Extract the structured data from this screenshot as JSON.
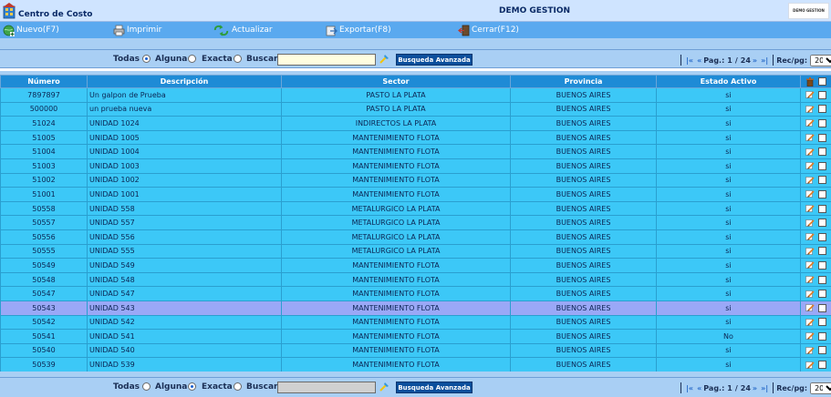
{
  "titlebar": {
    "app_title": "Centro de Costo",
    "company_title": "DEMO GESTION",
    "company_logo_text": "DEMO GESTION"
  },
  "toolbar": {
    "nuevo_label": "Nuevo(F7)",
    "imprimir_label": "Imprimir",
    "actualizar_label": "Actualizar",
    "exportar_label": "Exportar(F8)",
    "cerrar_label": "Cerrar(F12)"
  },
  "search_top": {
    "todas_label": "Todas",
    "alguna_label": "Alguna",
    "exacta_label": "Exacta",
    "buscar_label": "Buscar",
    "search_value": "",
    "selected_mode": "Todas",
    "advanced_label": "Busqueda Avanzada"
  },
  "search_bottom": {
    "todas_label": "Todas",
    "alguna_label": "Alguna",
    "exacta_label": "Exacta",
    "buscar_label": "Buscar",
    "search_value": "",
    "selected_mode": "Alguna",
    "advanced_label": "Busqueda Avanzada"
  },
  "pager": {
    "first": "|«",
    "prev": "«",
    "page_label": "Pag.:",
    "current_page": "1",
    "page_sep": "/",
    "total_pages": "24",
    "next": "»",
    "last": "»|",
    "recpg_label": "Rec/pg:",
    "recpg_value": "20"
  },
  "grid": {
    "headers": {
      "numero": "Número",
      "descripcion": "Descripción",
      "sector": "Sector",
      "provincia": "Provincia",
      "estado": "Estado Activo"
    },
    "rows": [
      {
        "numero": "7897897",
        "descripcion": "Un galpon de Prueba",
        "sector": "PASTO LA PLATA",
        "provincia": "BUENOS AIRES",
        "estado": "si"
      },
      {
        "numero": "500000",
        "descripcion": "un prueba nueva",
        "sector": "PASTO LA PLATA",
        "provincia": "BUENOS AIRES",
        "estado": "si"
      },
      {
        "numero": "51024",
        "descripcion": "UNIDAD 1024",
        "sector": "INDIRECTOS LA PLATA",
        "provincia": "BUENOS AIRES",
        "estado": "si"
      },
      {
        "numero": "51005",
        "descripcion": "UNIDAD 1005",
        "sector": "MANTENIMIENTO FLOTA",
        "provincia": "BUENOS AIRES",
        "estado": "si"
      },
      {
        "numero": "51004",
        "descripcion": "UNIDAD 1004",
        "sector": "MANTENIMIENTO FLOTA",
        "provincia": "BUENOS AIRES",
        "estado": "si"
      },
      {
        "numero": "51003",
        "descripcion": "UNIDAD 1003",
        "sector": "MANTENIMIENTO FLOTA",
        "provincia": "BUENOS AIRES",
        "estado": "si"
      },
      {
        "numero": "51002",
        "descripcion": "UNIDAD 1002",
        "sector": "MANTENIMIENTO FLOTA",
        "provincia": "BUENOS AIRES",
        "estado": "si"
      },
      {
        "numero": "51001",
        "descripcion": "UNIDAD 1001",
        "sector": "MANTENIMIENTO FLOTA",
        "provincia": "BUENOS AIRES",
        "estado": "si"
      },
      {
        "numero": "50558",
        "descripcion": "UNIDAD 558",
        "sector": "METALURGICO LA PLATA",
        "provincia": "BUENOS AIRES",
        "estado": "si"
      },
      {
        "numero": "50557",
        "descripcion": "UNIDAD 557",
        "sector": "METALURGICO LA PLATA",
        "provincia": "BUENOS AIRES",
        "estado": "si"
      },
      {
        "numero": "50556",
        "descripcion": "UNIDAD 556",
        "sector": "METALURGICO LA PLATA",
        "provincia": "BUENOS AIRES",
        "estado": "si"
      },
      {
        "numero": "50555",
        "descripcion": "UNIDAD 555",
        "sector": "METALURGICO LA PLATA",
        "provincia": "BUENOS AIRES",
        "estado": "si"
      },
      {
        "numero": "50549",
        "descripcion": "UNIDAD 549",
        "sector": "MANTENIMIENTO FLOTA",
        "provincia": "BUENOS AIRES",
        "estado": "si"
      },
      {
        "numero": "50548",
        "descripcion": "UNIDAD 548",
        "sector": "MANTENIMIENTO FLOTA",
        "provincia": "BUENOS AIRES",
        "estado": "si"
      },
      {
        "numero": "50547",
        "descripcion": "UNIDAD 547",
        "sector": "MANTENIMIENTO FLOTA",
        "provincia": "BUENOS AIRES",
        "estado": "si"
      },
      {
        "numero": "50543",
        "descripcion": "UNIDAD 543",
        "sector": "MANTENIMIENTO FLOTA",
        "provincia": "BUENOS AIRES",
        "estado": "si",
        "selected": true
      },
      {
        "numero": "50542",
        "descripcion": "UNIDAD 542",
        "sector": "MANTENIMIENTO FLOTA",
        "provincia": "BUENOS AIRES",
        "estado": "si"
      },
      {
        "numero": "50541",
        "descripcion": "UNIDAD 541",
        "sector": "MANTENIMIENTO FLOTA",
        "provincia": "BUENOS AIRES",
        "estado": "No"
      },
      {
        "numero": "50540",
        "descripcion": "UNIDAD 540",
        "sector": "MANTENIMIENTO FLOTA",
        "provincia": "BUENOS AIRES",
        "estado": "si"
      },
      {
        "numero": "50539",
        "descripcion": "UNIDAD 539",
        "sector": "MANTENIMIENTO FLOTA",
        "provincia": "BUENOS AIRES",
        "estado": "si"
      }
    ]
  },
  "colors": {
    "toolbar_bg": "#5aa9ef",
    "header_bg": "#1e8bd6",
    "row_bg": "#3cc8f7",
    "selected_row_bg": "#9aa8f7",
    "advanced_button_bg": "#0b4f9c"
  },
  "icons": {
    "app": "building-icon",
    "nuevo": "add-globe-icon",
    "imprimir": "printer-icon",
    "actualizar": "refresh-icon",
    "exportar": "export-icon",
    "cerrar": "exit-door-icon",
    "row_edit": "edit-icon",
    "header_delete": "trash-icon"
  }
}
